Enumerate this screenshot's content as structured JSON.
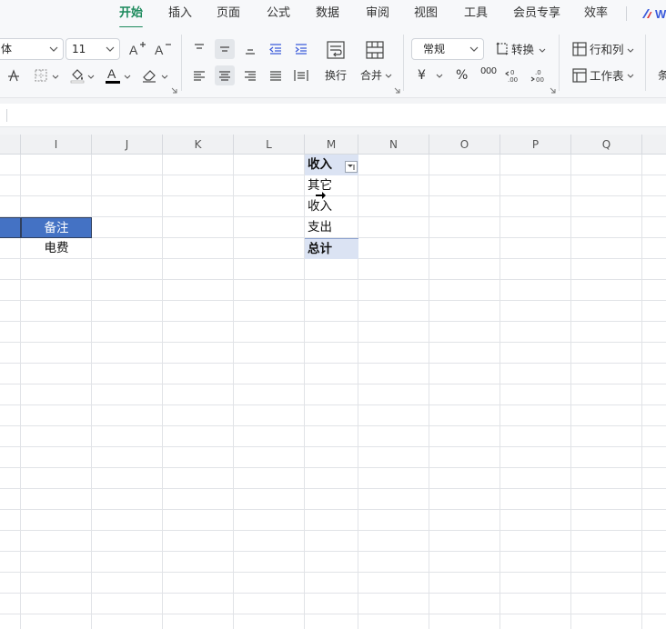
{
  "menu": {
    "tabs": [
      {
        "label": "开始",
        "active": true
      },
      {
        "label": "插入"
      },
      {
        "label": "页面"
      },
      {
        "label": "公式"
      },
      {
        "label": "数据"
      },
      {
        "label": "审阅"
      },
      {
        "label": "视图"
      },
      {
        "label": "工具"
      },
      {
        "label": "会员专享"
      },
      {
        "label": "效率"
      }
    ],
    "brand_letter": "W"
  },
  "ribbon": {
    "font_name": "体",
    "font_size": "11",
    "number_format": "常规",
    "convert_label": "转换",
    "wrap_label": "换行",
    "merge_label": "合并",
    "rows_cols_label": "行和列",
    "worksheet_label": "工作表",
    "cut_off_label": "条",
    "currency_symbol": "¥",
    "percent_symbol": "%",
    "thousands_symbol": "000",
    "font_color": "#000000"
  },
  "columns": [
    "I",
    "J",
    "K",
    "L",
    "M",
    "N",
    "O",
    "P",
    "Q"
  ],
  "cells": {
    "i_header": "备注",
    "i_value": "电费",
    "m_header": "收入",
    "m_items": [
      "其它",
      "收入",
      "支出"
    ],
    "m_total": "总计"
  },
  "colors": {
    "header_fill": "#4472c4",
    "pivot_band": "#dbe3f3",
    "accent": "#1c8a5c"
  }
}
